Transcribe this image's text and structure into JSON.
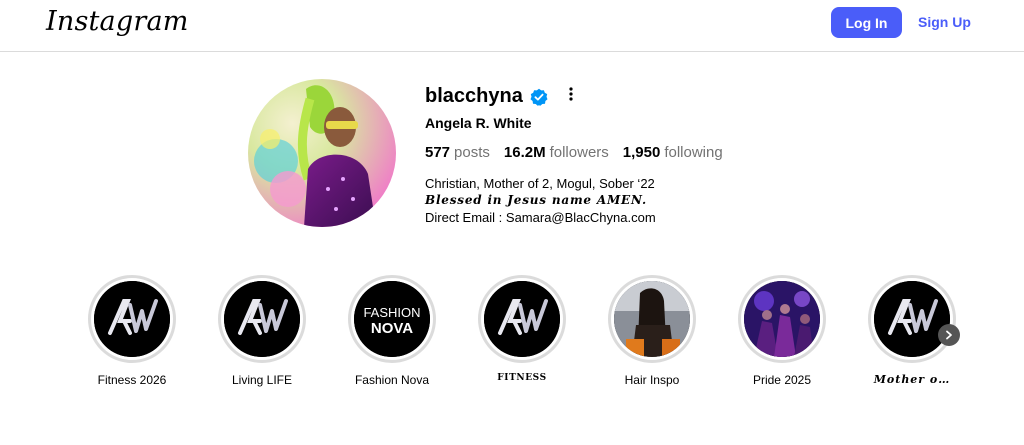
{
  "header": {
    "logo_text": "Instagram",
    "login_label": "Log In",
    "signup_label": "Sign Up",
    "accent_color": "#4a5df9"
  },
  "profile": {
    "username": "blacchyna",
    "verified": true,
    "full_name": "Angela R. White",
    "stats": [
      {
        "value": "577",
        "label": "posts"
      },
      {
        "value": "16.2M",
        "label": "followers"
      },
      {
        "value": "1,950",
        "label": "following"
      }
    ],
    "bio_lines": [
      "Christian, Mother of 2, Mogul, Sober ‘22",
      "Blessed in Jesus name AMEN.",
      "Direct Email : Samara@BlacChyna.com"
    ]
  },
  "highlights": [
    {
      "label": "Fitness 2026",
      "cover": "aw-logo"
    },
    {
      "label": "Living LIFE",
      "cover": "aw-logo"
    },
    {
      "label": "Fashion Nova",
      "cover": "fashion-nova-logo",
      "cover_text": [
        "FASHION",
        "NOVA"
      ]
    },
    {
      "label": "FITNESS",
      "cover": "aw-logo"
    },
    {
      "label": "Hair Inspo",
      "cover": "photo"
    },
    {
      "label": "Pride 2025",
      "cover": "photo"
    },
    {
      "label": "Mother o…",
      "cover": "aw-logo"
    }
  ],
  "icons": {
    "verified": "verified-badge-icon",
    "more": "more-options-icon",
    "next": "chevron-right-icon"
  }
}
